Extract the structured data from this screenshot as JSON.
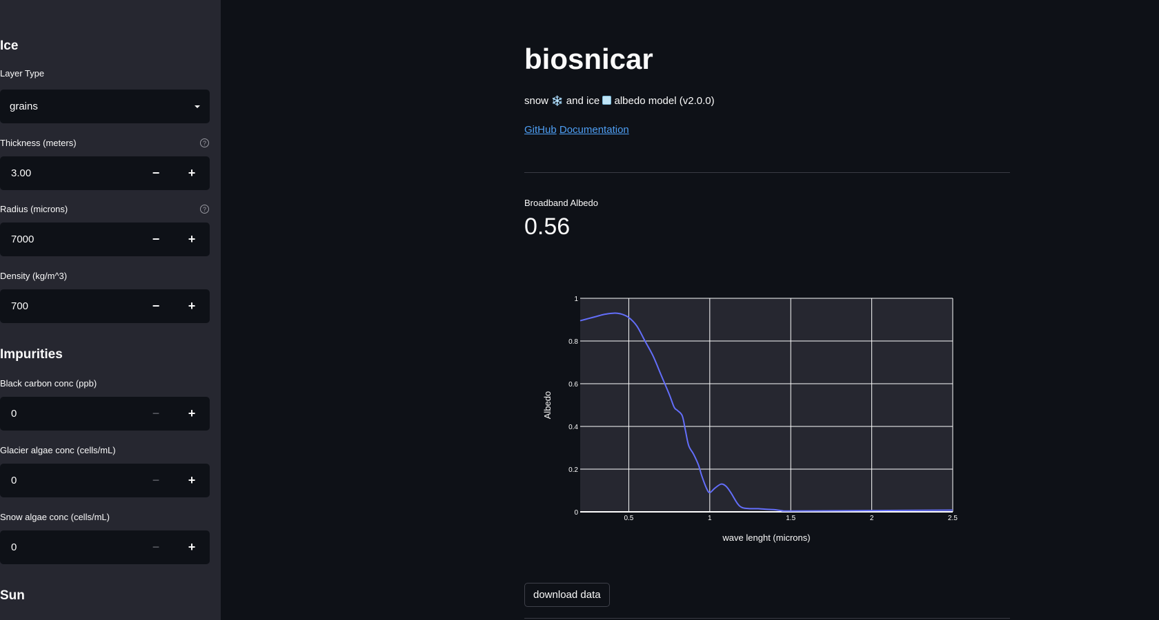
{
  "sidebar": {
    "ice_title": "Ice",
    "layer_type": {
      "label": "Layer Type",
      "value": "grains"
    },
    "thickness": {
      "label": "Thickness (meters)",
      "value": "3.00"
    },
    "radius": {
      "label": "Radius (microns)",
      "value": "7000"
    },
    "density": {
      "label": "Density (kg/m^3)",
      "value": "700"
    },
    "impurities_title": "Impurities",
    "black_carbon": {
      "label": "Black carbon conc (ppb)",
      "value": "0"
    },
    "glacier_algae": {
      "label": "Glacier algae conc (cells/mL)",
      "value": "0"
    },
    "snow_algae": {
      "label": "Snow algae conc (cells/mL)",
      "value": "0"
    },
    "sun_title": "Sun",
    "help_glyph": "?",
    "minus_glyph": "−",
    "plus_glyph": "+"
  },
  "main": {
    "title": "biosnicar",
    "subtitle_pre": "snow ",
    "subtitle_snow_emoji": "❄️",
    "subtitle_mid": " and ice ",
    "subtitle_post": " albedo model (v2.0.0)",
    "link_github": "GitHub",
    "link_docs": "Documentation",
    "metric_label": "Broadband Albedo",
    "metric_value": "0.56",
    "download_label": "download data"
  },
  "colors": {
    "line": "#636efa",
    "link": "#4e9ff5",
    "plot_bg": "#262730",
    "grid": "#ffffff"
  },
  "chart_data": {
    "type": "line",
    "title": "",
    "xlabel": "wave lenght (microns)",
    "ylabel": "Albedo",
    "xlim": [
      0.2,
      2.5
    ],
    "ylim": [
      0,
      1
    ],
    "grid": true,
    "xticks": [
      0.5,
      1,
      1.5,
      2,
      2.5
    ],
    "xtick_labels": [
      "0.5",
      "1",
      "1.5",
      "2",
      "2.5"
    ],
    "yticks": [
      0,
      0.2,
      0.4,
      0.6,
      0.8,
      1
    ],
    "ytick_labels": [
      "0",
      "0.2",
      "0.4",
      "0.6",
      "0.8",
      "1"
    ],
    "series": [
      {
        "x": [
          0.2,
          0.25,
          0.3,
          0.35,
          0.4,
          0.43,
          0.46,
          0.5,
          0.55,
          0.6,
          0.65,
          0.7,
          0.75,
          0.78,
          0.8,
          0.83,
          0.85,
          0.87,
          0.9,
          0.93,
          0.95,
          0.98,
          1.0,
          1.03,
          1.07,
          1.1,
          1.13,
          1.17,
          1.2,
          1.25,
          1.3,
          1.35,
          1.4,
          1.45,
          1.5,
          2.0,
          2.5
        ],
        "y": [
          0.895,
          0.905,
          0.915,
          0.925,
          0.93,
          0.93,
          0.925,
          0.91,
          0.87,
          0.8,
          0.73,
          0.64,
          0.55,
          0.49,
          0.475,
          0.45,
          0.38,
          0.31,
          0.27,
          0.22,
          0.17,
          0.11,
          0.09,
          0.11,
          0.13,
          0.12,
          0.09,
          0.04,
          0.02,
          0.015,
          0.015,
          0.012,
          0.01,
          0.005,
          0.004,
          0.006,
          0.008
        ]
      }
    ]
  }
}
